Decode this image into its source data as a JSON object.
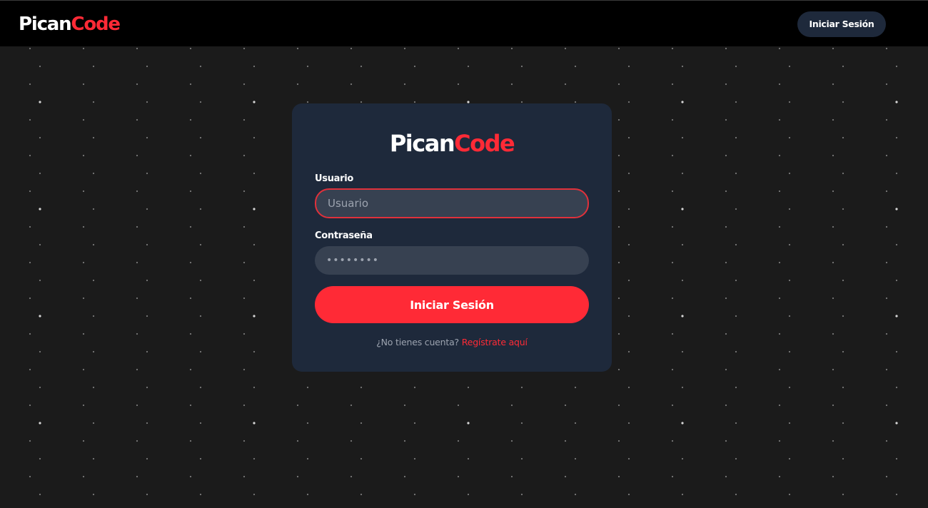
{
  "brand": {
    "name_part1": "Pican",
    "name_part2": "Code",
    "color_primary": "#ffffff",
    "color_accent": "#ff2a36"
  },
  "navbar": {
    "login_button_label": "Iniciar Sesión"
  },
  "login_form": {
    "username_label": "Usuario",
    "username_placeholder": "Usuario",
    "username_value": "",
    "password_label": "Contraseña",
    "password_value": "••••••••",
    "submit_label": "Iniciar Sesión",
    "register_prompt": "¿No tienes cuenta?",
    "register_link": "Regístrate aquí"
  },
  "colors": {
    "page_background": "#1b1b1b",
    "navbar_background": "#000000",
    "card_background": "#1e293b",
    "input_background": "#374151",
    "focus_border": "#e0313b"
  }
}
